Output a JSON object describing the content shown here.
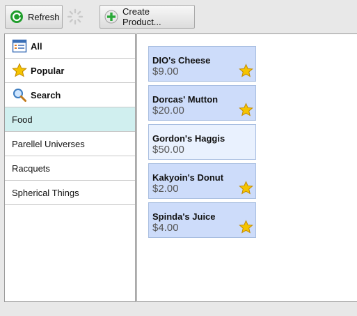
{
  "toolbar": {
    "refresh_label": "Refresh",
    "create_label": "Create Product..."
  },
  "sidebar": {
    "items": [
      {
        "label": "All",
        "icon": "all-list-icon",
        "bold": true
      },
      {
        "label": "Popular",
        "icon": "star-icon",
        "bold": true
      },
      {
        "label": "Search",
        "icon": "magnifier-icon",
        "bold": true
      },
      {
        "label": "Food",
        "selected": true
      },
      {
        "label": "Parellel Universes"
      },
      {
        "label": "Racquets"
      },
      {
        "label": "Spherical Things"
      }
    ]
  },
  "products": [
    {
      "name": "DIO's Cheese",
      "price": "$9.00",
      "starred": true
    },
    {
      "name": "Dorcas' Mutton",
      "price": "$20.00",
      "starred": true
    },
    {
      "name": "Gordon's Haggis",
      "price": "$50.00",
      "starred": false
    },
    {
      "name": "Kakyoin's Donut",
      "price": "$2.00",
      "starred": true
    },
    {
      "name": "Spinda's Juice",
      "price": "$4.00",
      "starred": true
    }
  ],
  "colors": {
    "card_starred": "#cddcfa",
    "card_plain": "#e9f1fe",
    "selected_nav": "#d0efef",
    "star": "#f5c400"
  }
}
